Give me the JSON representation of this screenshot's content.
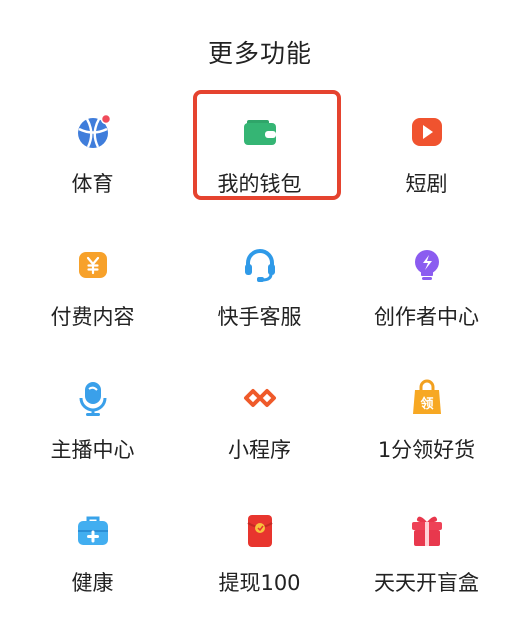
{
  "title": "更多功能",
  "colors": {
    "highlight": "#e5432f",
    "accent_red": "#f04b5a"
  },
  "items": [
    {
      "label": "体育",
      "icon": "basketball-icon"
    },
    {
      "label": "我的钱包",
      "icon": "wallet-icon",
      "selected": true
    },
    {
      "label": "短剧",
      "icon": "play-icon"
    },
    {
      "label": "付费内容",
      "icon": "yen-icon"
    },
    {
      "label": "快手客服",
      "icon": "headset-icon"
    },
    {
      "label": "创作者中心",
      "icon": "bulb-icon"
    },
    {
      "label": "主播中心",
      "icon": "microphone-icon"
    },
    {
      "label": "小程序",
      "icon": "mini-program-icon"
    },
    {
      "label": "1分领好货",
      "icon": "shopping-bag-icon",
      "badge": "领"
    },
    {
      "label": "健康",
      "icon": "medical-kit-icon"
    },
    {
      "label": "提现100",
      "icon": "red-envelope-icon"
    },
    {
      "label": "天天开盲盒",
      "icon": "gift-box-icon"
    }
  ]
}
